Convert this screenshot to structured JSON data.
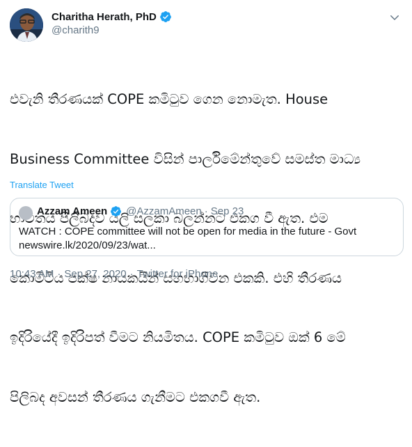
{
  "author": {
    "name": "Charitha Herath, PhD",
    "handle": "@charith9",
    "verified": true
  },
  "tweet_lines": [
    "එවැනි තීරණයක් COPE කමිටුව ගෙන නොමැත. House",
    "Business Committee විසින් පාර්ලිමේන්තුවේ සමස්ත මාධ්‍ය",
    "භාවිතය පිලිබදව යලි සලකා බලන්නට එකග වී ඇත. එම",
    "කොමිටිය පක්ෂ නායකයින් සහභාගිවන එකකි.  එහි තීරණය",
    "ඉදිරියේදී ඉදිරිපත් වීමට නියමිතය. COPE කමිටුව ඔක් 6  මේ",
    "පිලිබද අවසන් තීරණය ගැනීමට එකගවී ඇත."
  ],
  "translate_label": "Translate Tweet",
  "quote": {
    "name": "Azzam Ameen",
    "verified": true,
    "handle": "@AzzamAmeen",
    "separator": "·",
    "date": "Sep 23",
    "text_lines": [
      "WATCH : COPE committee will not be open for media in the future - Govt",
      "newswire.lk/2020/09/23/wat..."
    ]
  },
  "footer": {
    "time": "10:43 AM",
    "separator": "·",
    "date": "Sep 27, 2020",
    "source": "Twitter for iPhone"
  },
  "icons": {
    "verified": "verified-badge-icon",
    "more": "chevron-down-icon"
  },
  "colors": {
    "link": "#1da1f2",
    "muted": "#657786",
    "border": "#ccd6dd"
  }
}
